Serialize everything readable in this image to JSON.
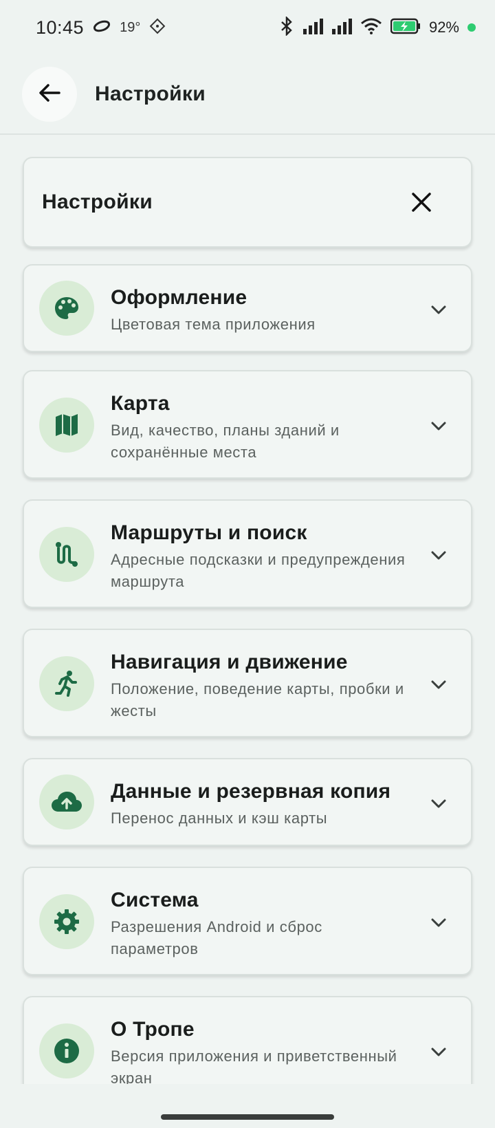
{
  "status_bar": {
    "time": "10:45",
    "temperature": "19°",
    "battery_percent": "92%",
    "icons": [
      "vpn-icon",
      "weather-icon",
      "bluetooth-icon",
      "signal-icon",
      "signal-icon",
      "wifi-icon",
      "battery-charging-icon"
    ]
  },
  "app_bar": {
    "title": "Настройки",
    "back_icon": "arrow-back-icon"
  },
  "search_card": {
    "title": "Настройки",
    "close_icon": "close-icon"
  },
  "sections": [
    {
      "title": "Оформление",
      "subtitle": "Цветовая тема приложения",
      "icon": "palette-icon"
    },
    {
      "title": "Карта",
      "subtitle": "Вид, качество, планы зданий и сохранённые места",
      "icon": "map-icon"
    },
    {
      "title": "Маршруты и поиск",
      "subtitle": "Адресные подсказки и предупреждения маршрута",
      "icon": "route-icon"
    },
    {
      "title": "Навигация и движение",
      "subtitle": "Положение, поведение карты, пробки и жесты",
      "icon": "running-icon"
    },
    {
      "title": "Данные и резервная копия",
      "subtitle": "Перенос данных и кэш карты",
      "icon": "cloud-upload-icon"
    },
    {
      "title": "Система",
      "subtitle": "Разрешения Android и сброс параметров",
      "icon": "gear-icon"
    },
    {
      "title": "О Тропе",
      "subtitle": "Версия приложения и приветственный экран",
      "icon": "info-icon"
    }
  ],
  "colors": {
    "background": "#eef3f1",
    "card": "#f2f6f4",
    "icon_bg": "#d9ecd6",
    "icon_fg": "#1d6b45",
    "battery": "#2ecc71"
  }
}
